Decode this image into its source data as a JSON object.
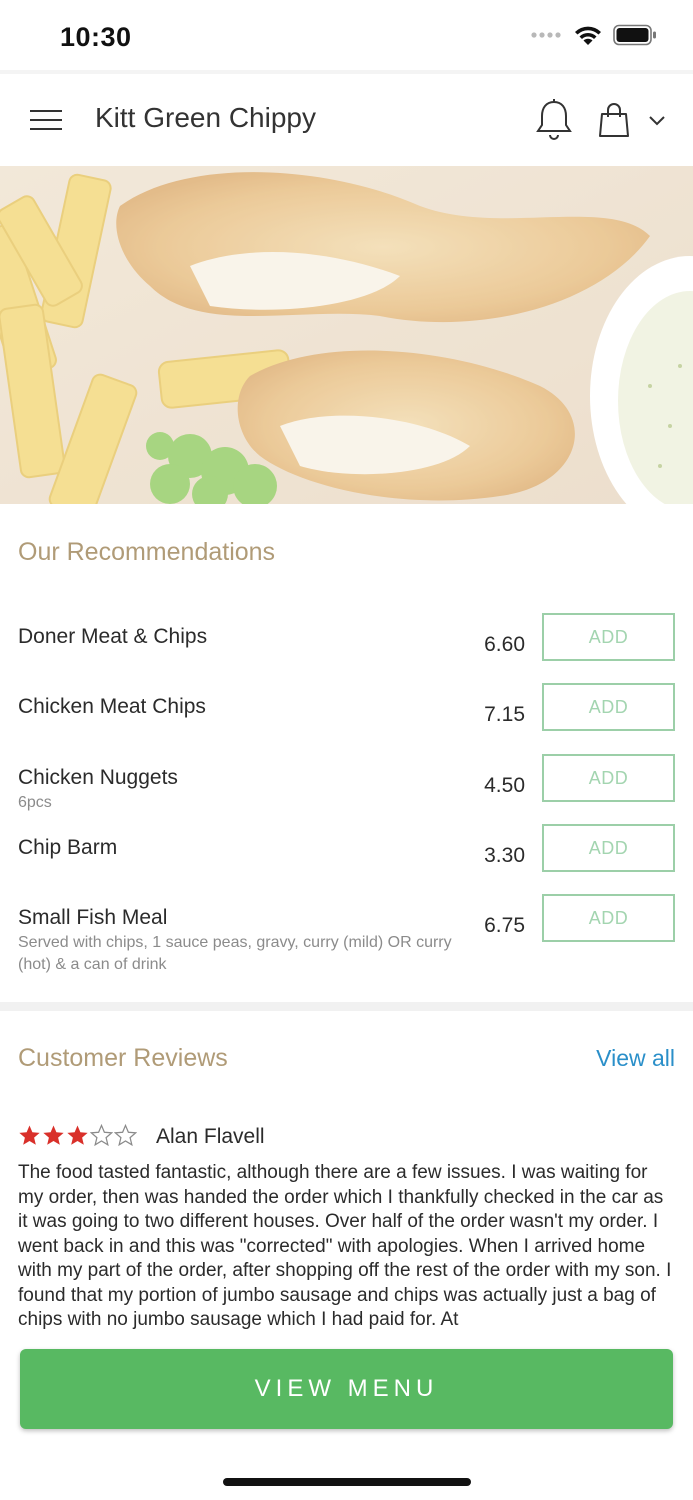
{
  "status_bar": {
    "time": "10:30"
  },
  "header": {
    "title": "Kitt Green Chippy"
  },
  "recommendations": {
    "title": "Our Recommendations",
    "items": [
      {
        "name": "Doner Meat & Chips",
        "desc": "",
        "price": "6.60",
        "add_label": "ADD"
      },
      {
        "name": "Chicken Meat Chips",
        "desc": "",
        "price": "7.15",
        "add_label": "ADD"
      },
      {
        "name": "Chicken Nuggets",
        "desc": "6pcs",
        "price": "4.50",
        "add_label": "ADD"
      },
      {
        "name": "Chip Barm",
        "desc": "",
        "price": "3.30",
        "add_label": "ADD"
      },
      {
        "name": "Small Fish Meal",
        "desc": "Served with chips, 1 sauce peas, gravy, curry (mild) OR curry (hot) & a can of drink",
        "price": "6.75",
        "add_label": "ADD"
      }
    ]
  },
  "reviews": {
    "title": "Customer Reviews",
    "view_all": "View all",
    "items": [
      {
        "rating": 3,
        "max_rating": 5,
        "author": "Alan Flavell",
        "text": "The food tasted fantastic, although there are a few issues. I was waiting for my order, then was handed the order which I thankfully checked in the car as it was going to two different houses. Over half of the order wasn't my order. I went back in and this was \"corrected\" with apologies. When I arrived home with my part of the order, after shopping off the rest of the order with my son. I found that my portion of jumbo sausage and chips was actually just a bag of chips with no jumbo sausage which I had paid for. At"
      }
    ]
  },
  "footer": {
    "view_menu_label": "VIEW MENU"
  },
  "colors": {
    "accent_green": "#58b962",
    "add_border": "#9ccfa8",
    "section_title": "#b09b77",
    "link_blue": "#2a8fc9",
    "star_red": "#d9302a"
  },
  "icons": [
    "hamburger-menu-icon",
    "bell-icon",
    "shopping-bag-icon",
    "chevron-down-icon",
    "wifi-icon",
    "battery-icon",
    "signal-icon",
    "star-icon"
  ]
}
